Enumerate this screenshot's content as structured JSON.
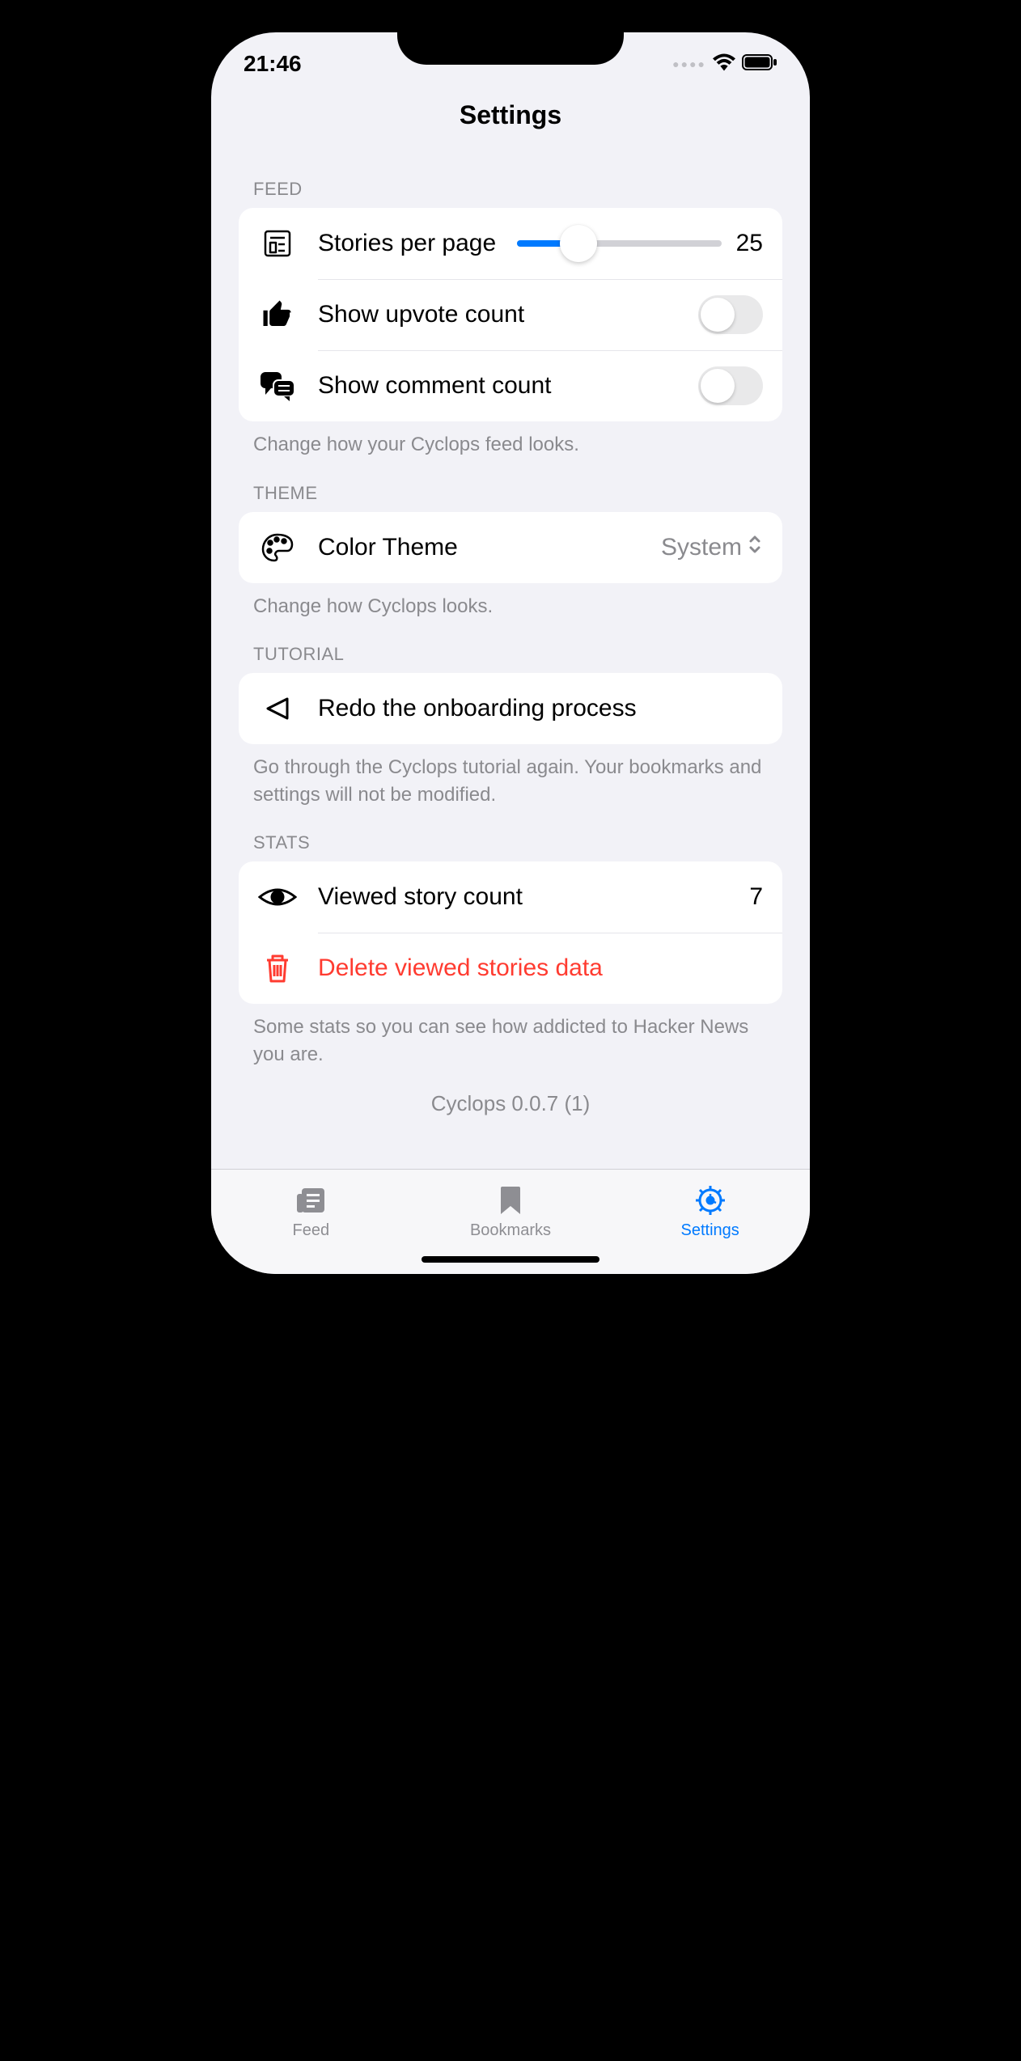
{
  "status": {
    "time": "21:46"
  },
  "title": "Settings",
  "sections": {
    "feed": {
      "header": "FEED",
      "footer": "Change how your Cyclops feed looks.",
      "stories_label": "Stories per page",
      "stories_value": "25",
      "slider_percent": 30,
      "upvote_label": "Show upvote count",
      "comment_label": "Show comment count"
    },
    "theme": {
      "header": "THEME",
      "footer": "Change how Cyclops looks.",
      "label": "Color Theme",
      "value": "System"
    },
    "tutorial": {
      "header": "TUTORIAL",
      "footer": "Go through the Cyclops tutorial again. Your bookmarks and settings will not be modified.",
      "label": "Redo the onboarding process"
    },
    "stats": {
      "header": "STATS",
      "footer": "Some stats so you can see how addicted to Hacker News you are.",
      "viewed_label": "Viewed story count",
      "viewed_value": "7",
      "delete_label": "Delete viewed stories data"
    }
  },
  "version": "Cyclops 0.0.7 (1)",
  "tabs": {
    "feed": "Feed",
    "bookmarks": "Bookmarks",
    "settings": "Settings"
  }
}
